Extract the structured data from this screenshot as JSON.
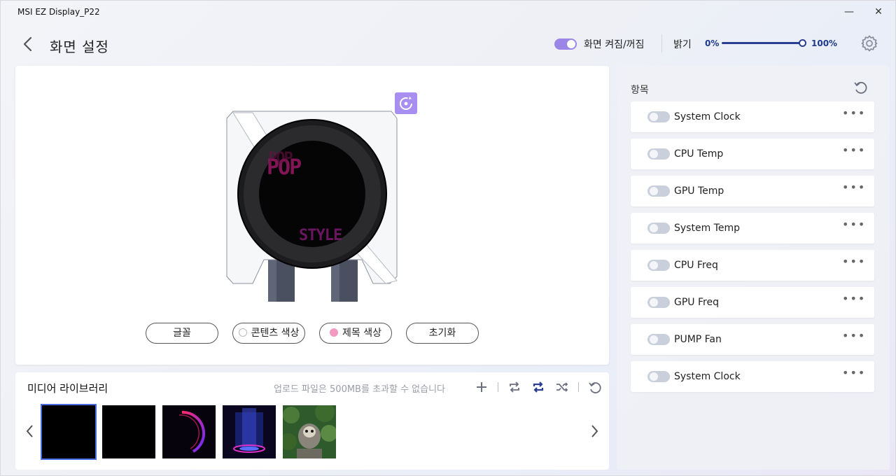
{
  "window": {
    "title": "MSI EZ Display_P22"
  },
  "header": {
    "title": "화면 설정",
    "power_label": "화면 켜짐/꺼짐",
    "brightness_label": "밝기",
    "brightness_min": "0%",
    "brightness_max": "100%",
    "brightness_value": 1.0,
    "power_on": true
  },
  "preview": {
    "controls": [
      {
        "label": "글꼴"
      },
      {
        "label": "콘텐츠 색상"
      },
      {
        "label": "제목 색상"
      },
      {
        "label": "초기화"
      }
    ]
  },
  "media": {
    "title": "미디어 라이브러리",
    "note": "업로드 파일은 500MB를 초과할 수 없습니다"
  },
  "items": {
    "label": "항목",
    "list": [
      {
        "label": "System Clock",
        "enabled": false
      },
      {
        "label": "CPU Temp",
        "enabled": false
      },
      {
        "label": "GPU Temp",
        "enabled": false
      },
      {
        "label": "System Temp",
        "enabled": false
      },
      {
        "label": "CPU Freq",
        "enabled": false
      },
      {
        "label": "GPU Freq",
        "enabled": false
      },
      {
        "label": "PUMP Fan",
        "enabled": false
      },
      {
        "label": "System Clock",
        "enabled": false
      }
    ]
  },
  "colors": {
    "accent": "#9b86e8",
    "slider": "#2a3f91",
    "title_color_dot": "#f29ac0"
  }
}
